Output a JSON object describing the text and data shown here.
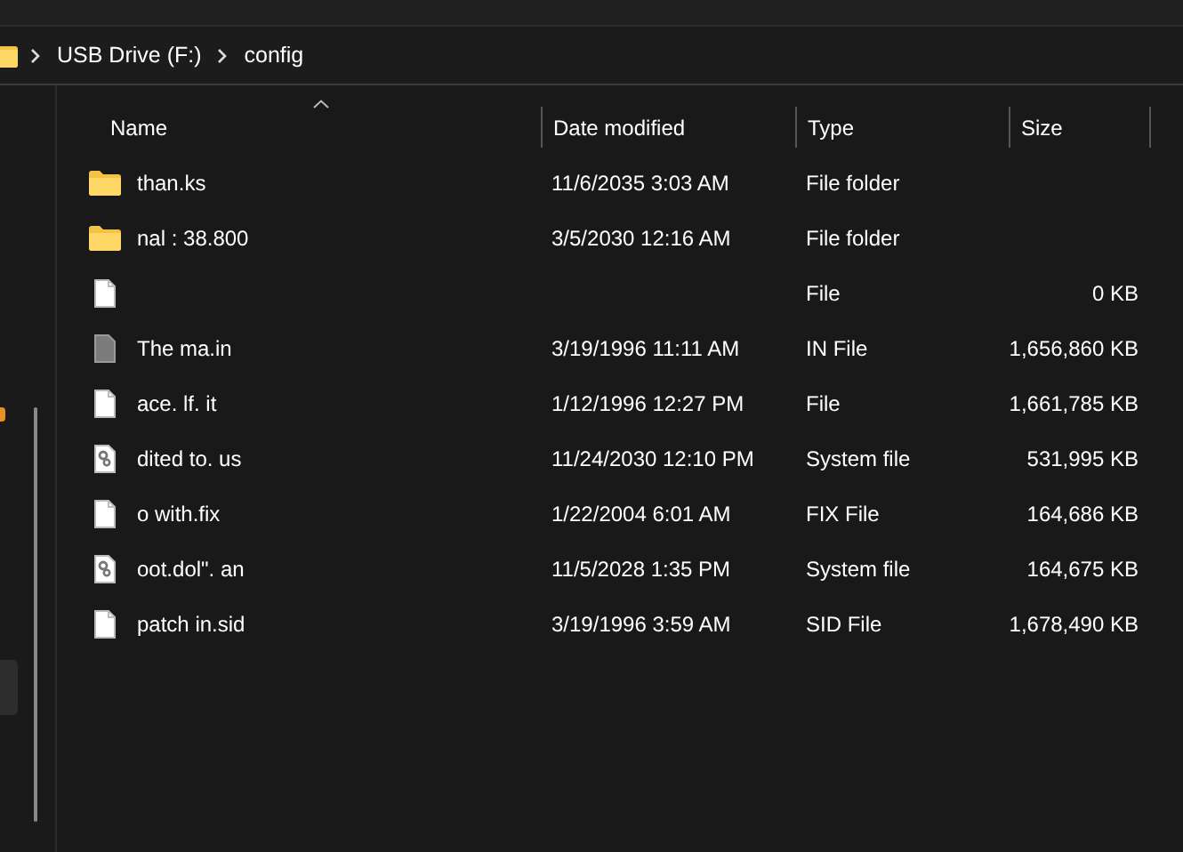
{
  "address_bar": {
    "crumbs": [
      "USB Drive (F:)",
      "config"
    ]
  },
  "nav_pane": {
    "items": [
      {
        "selected": true
      }
    ]
  },
  "file_list": {
    "columns": [
      {
        "label": "Name",
        "sorted": true
      },
      {
        "label": "Date modified",
        "sorted": false
      },
      {
        "label": "Type",
        "sorted": false
      },
      {
        "label": "Size",
        "sorted": false
      }
    ],
    "rows": [
      {
        "kind": "folder",
        "name": "than.ks",
        "date": "11/6/2035 3:03 AM",
        "type": "File folder"
      },
      {
        "kind": "folder",
        "name": "nal : 38.800",
        "date": "3/5/2030 12:16 AM",
        "type": "File folder"
      },
      {
        "kind": "file",
        "name": "",
        "type": "File",
        "size": "0 KB"
      },
      {
        "kind": "dark-file",
        "name": "The ma.in",
        "date": "3/19/1996 11:11 AM",
        "type": "IN File",
        "size": "1,656,860 KB"
      },
      {
        "kind": "file",
        "name": "ace. lf. it",
        "date": "1/12/1996 12:27 PM",
        "type": "File",
        "size": "1,661,785 KB"
      },
      {
        "kind": "system",
        "name": "dited to. us",
        "date": "11/24/2030 12:10 PM",
        "type": "System file",
        "size": "531,995 KB"
      },
      {
        "kind": "file",
        "name": "o with.fix",
        "date": "1/22/2004 6:01 AM",
        "type": "FIX File",
        "size": "164,686 KB"
      },
      {
        "kind": "system",
        "name": "oot.dol\". an",
        "date": "11/5/2028 1:35 PM",
        "type": "System file",
        "size": "164,675 KB"
      },
      {
        "kind": "file",
        "name": "patch in.sid",
        "date": "3/19/1996 3:59 AM",
        "type": "SID File",
        "size": "1,678,490 KB"
      }
    ]
  }
}
